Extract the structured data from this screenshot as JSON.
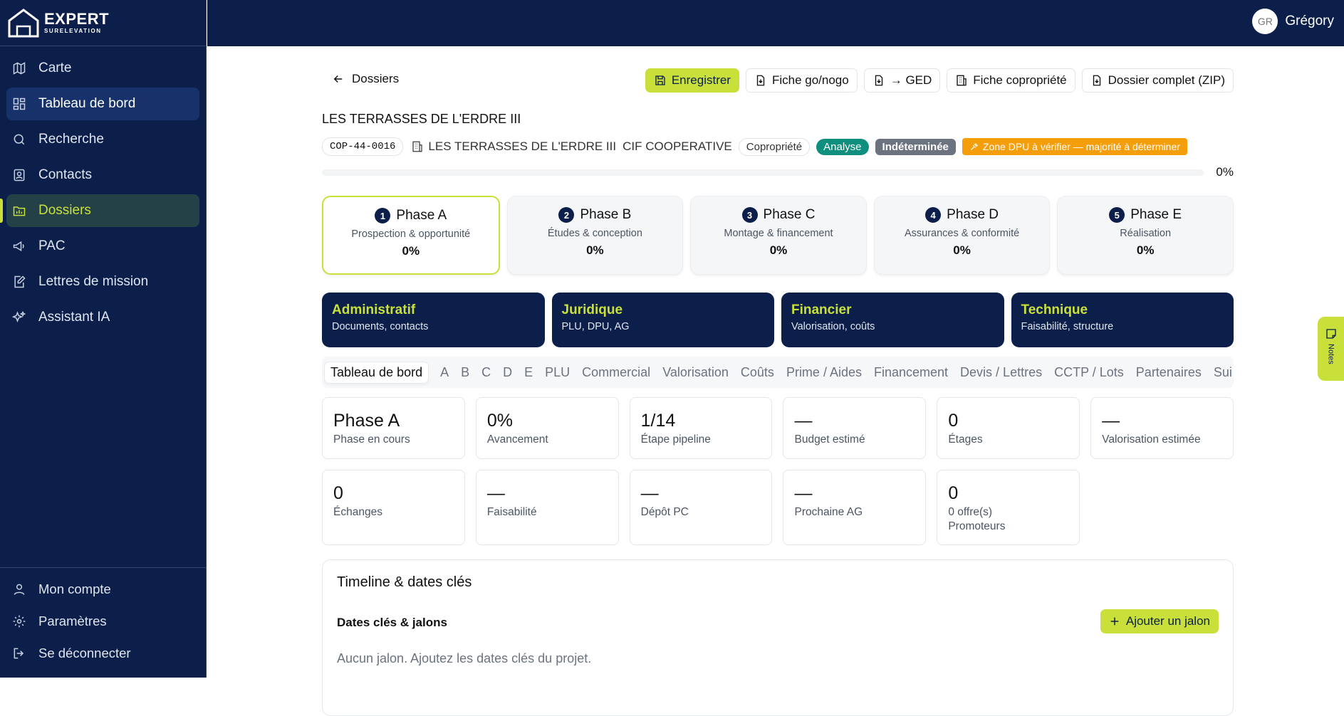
{
  "app": {
    "logo_main": "EXPERT",
    "logo_sub": "SURELEVATION"
  },
  "user": {
    "initials": "GR",
    "name": "Grégory"
  },
  "sidebar": {
    "items": [
      {
        "label": "Carte"
      },
      {
        "label": "Tableau de bord"
      },
      {
        "label": "Recherche"
      },
      {
        "label": "Contacts"
      },
      {
        "label": "Dossiers"
      },
      {
        "label": "PAC"
      },
      {
        "label": "Lettres de mission"
      },
      {
        "label": "Assistant IA"
      }
    ],
    "bottom": [
      {
        "label": "Mon compte"
      },
      {
        "label": "Paramètres"
      },
      {
        "label": "Se déconnecter"
      }
    ]
  },
  "header": {
    "back_label": "Dossiers",
    "actions": [
      "Enregistrer",
      "Fiche go/nogo",
      "→ GED",
      "Fiche copropriété",
      "Dossier complet (ZIP)"
    ],
    "title": "LES TERRASSES DE L'ERDRE III",
    "code": "COP-44-0016",
    "building": "LES TERRASSES DE L'ERDRE III",
    "company": "CIF COOPERATIVE",
    "badges": {
      "type": "Copropriété",
      "status": "Analyse",
      "verdict": "Indéterminée",
      "warning": "Zone DPU à vérifier — majorité à déterminer"
    },
    "progress_label": "0%",
    "progress_value": 0
  },
  "phases": [
    {
      "num": "1",
      "name": "Phase A",
      "sub": "Prospection & opportunité",
      "pct": "0%"
    },
    {
      "num": "2",
      "name": "Phase B",
      "sub": "Études & conception",
      "pct": "0%"
    },
    {
      "num": "3",
      "name": "Phase C",
      "sub": "Montage & financement",
      "pct": "0%"
    },
    {
      "num": "4",
      "name": "Phase D",
      "sub": "Assurances & conformité",
      "pct": "0%"
    },
    {
      "num": "5",
      "name": "Phase E",
      "sub": "Réalisation",
      "pct": "0%"
    }
  ],
  "categories": [
    {
      "title": "Administratif",
      "sub": "Documents, contacts"
    },
    {
      "title": "Juridique",
      "sub": "PLU, DPU, AG"
    },
    {
      "title": "Financier",
      "sub": "Valorisation, coûts"
    },
    {
      "title": "Technique",
      "sub": "Faisabilité, structure"
    }
  ],
  "tabs": [
    "Tableau de bord",
    "A",
    "B",
    "C",
    "D",
    "E",
    "PLU",
    "Commercial",
    "Valorisation",
    "Coûts",
    "Prime / Aides",
    "Financement",
    "Devis / Lettres",
    "CCTP / Lots",
    "Partenaires",
    "Sui"
  ],
  "stats": [
    {
      "value": "Phase A",
      "label": "Phase en cours"
    },
    {
      "value": "0%",
      "label": "Avancement"
    },
    {
      "value": "1/14",
      "label": "Étape pipeline"
    },
    {
      "value": "—",
      "label": "Budget estimé"
    },
    {
      "value": "0",
      "label": "Étages"
    },
    {
      "value": "—",
      "label": "Valorisation estimée"
    },
    {
      "value": "0",
      "label": "Échanges"
    },
    {
      "value": "—",
      "label": "Faisabilité"
    },
    {
      "value": "—",
      "label": "Dépôt PC"
    },
    {
      "value": "—",
      "label": "Prochaine AG"
    },
    {
      "value": "0",
      "label": "0 offre(s)",
      "label2": "Promoteurs"
    }
  ],
  "timeline": {
    "title": "Timeline & dates clés",
    "subtitle": "Dates clés & jalons",
    "add_label": "Ajouter un jalon",
    "empty": "Aucun jalon. Ajoutez les dates clés du projet."
  },
  "notes_label": "Notes",
  "colors": {
    "navy": "#0c1f4a",
    "accent": "#c9e03a",
    "green": "#0f8f7e",
    "orange": "#f59e0b"
  }
}
